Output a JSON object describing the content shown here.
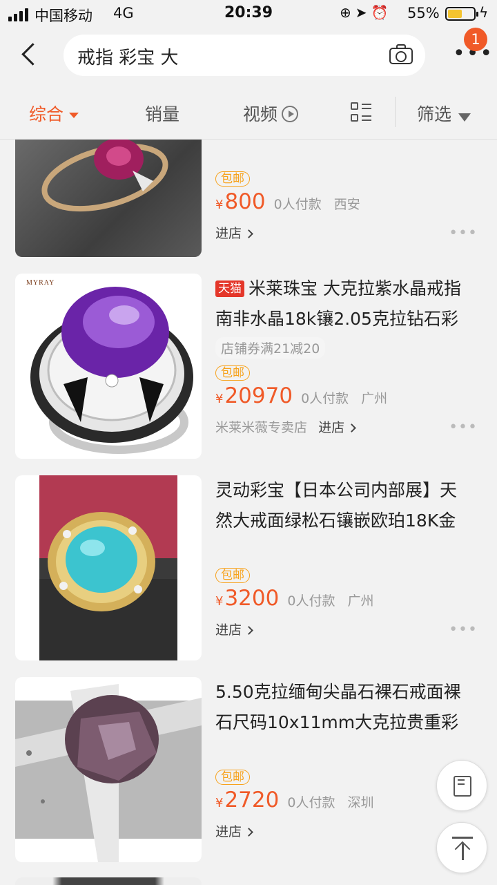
{
  "status_bar": {
    "carrier": "中国移动",
    "network": "4G",
    "time": "20:39",
    "battery_pct": "55%",
    "battery_level": 0.55
  },
  "header": {
    "search_query": "戒指 彩宝 大",
    "notification_count": "1"
  },
  "sort_tabs": {
    "comprehensive": "综合",
    "sales": "销量",
    "video": "视频",
    "filter": "筛选"
  },
  "colors": {
    "accent": "#f05a28",
    "free_shipping": "#f7a21b",
    "tmall": "#e4372a"
  },
  "products": [
    {
      "title_line1": "",
      "title_line2": "",
      "free_shipping": "包邮",
      "currency": "¥",
      "price": "800",
      "sold": "0人付款",
      "location": "西安",
      "shop": "",
      "enter": "进店"
    },
    {
      "badge": "天猫",
      "title_line1": "米莱珠宝 大克拉紫水晶戒指",
      "title_line2": "南非水晶18k镶2.05克拉钻石彩",
      "coupon": "店铺券满21减20",
      "free_shipping": "包邮",
      "currency": "¥",
      "price": "20970",
      "sold": "0人付款",
      "location": "广州",
      "shop": "米莱米薇专卖店",
      "enter": "进店",
      "logo_text": "MYRAY"
    },
    {
      "title_line1": "灵动彩宝【日本公司内部展】天",
      "title_line2": "然大戒面绿松石镶嵌欧珀18K金",
      "free_shipping": "包邮",
      "currency": "¥",
      "price": "3200",
      "sold": "0人付款",
      "location": "广州",
      "shop": "",
      "enter": "进店"
    },
    {
      "title_line1": "5.50克拉缅甸尖晶石裸石戒面裸",
      "title_line2": "石尺码10x11mm大克拉贵重彩",
      "free_shipping": "包邮",
      "currency": "¥",
      "price": "2720",
      "sold": "0人付款",
      "location": "深圳",
      "shop": "",
      "enter": "进店"
    }
  ]
}
